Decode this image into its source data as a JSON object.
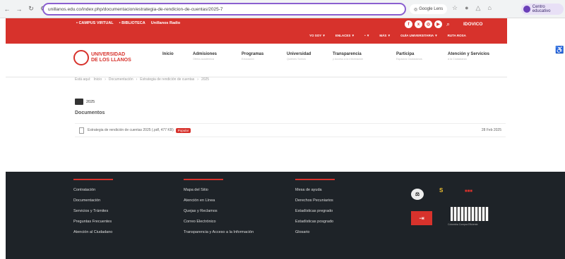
{
  "browser": {
    "url": "unillanos.edu.co/index.php/documentacion/estrategia-de-rendicion-de-cuentas/2025-7",
    "lens_label": "Google Lens",
    "profile_label": "Centro educativo"
  },
  "topbar": {
    "links": [
      "• CAMPUS VIRTUAL",
      "• BIBLIOTECA",
      "Unillanos Radio"
    ],
    "brand": "IDOVICO",
    "subnav": [
      "YO SOY ▼",
      "ENLACES ▼",
      "• ▼",
      "MÁS ▼",
      "GUÍA UNIVERSITARIA ▼",
      "RUTA ROSA"
    ]
  },
  "logo": {
    "line1": "UNIVERSIDAD",
    "line2": "DE LOS LLANOS"
  },
  "menu": [
    {
      "label": "Inicio",
      "sub": ""
    },
    {
      "label": "Admisiones",
      "sub": "Oferta académica"
    },
    {
      "label": "Programas",
      "sub": "Educación"
    },
    {
      "label": "Universidad",
      "sub": "Quiénes Somos"
    },
    {
      "label": "Transparencia",
      "sub": "y Acceso a la Información"
    },
    {
      "label": "Participa",
      "sub": "Espacios Ciudadanos"
    },
    {
      "label": "Atención y Servicios",
      "sub": "a la Ciudadanía"
    }
  ],
  "breadcrumb": [
    "Está aquí:",
    "Inicio",
    "Documentación",
    "Estrategia de rendición de cuentas",
    "2025"
  ],
  "folder": {
    "name": "2025"
  },
  "documents": {
    "title": "Documentos",
    "file": {
      "name": "Estrategia de rendición de cuentas 2025 (.pdf, 477 KB)",
      "badge": "Popular",
      "date": "28 Feb 2025"
    }
  },
  "footer": {
    "col1": [
      "Contratación",
      "Documentación",
      "Servicios y Trámites",
      "Preguntas Frecuentes",
      "Atención al Ciudadano"
    ],
    "col2": [
      "Mapa del Sitio",
      "Atención en Línea",
      "Quejas y Reclamos",
      "Correo Electrónico",
      "Transparencia y Acceso a la Información"
    ],
    "col3": [
      "Mesa de ayuda",
      "Derechos Pecuniarios",
      "Estadísticas pregrado",
      "Estadísticas posgrado",
      "Glosario"
    ],
    "logo_caption": "Colombia Compra Eficiente"
  }
}
